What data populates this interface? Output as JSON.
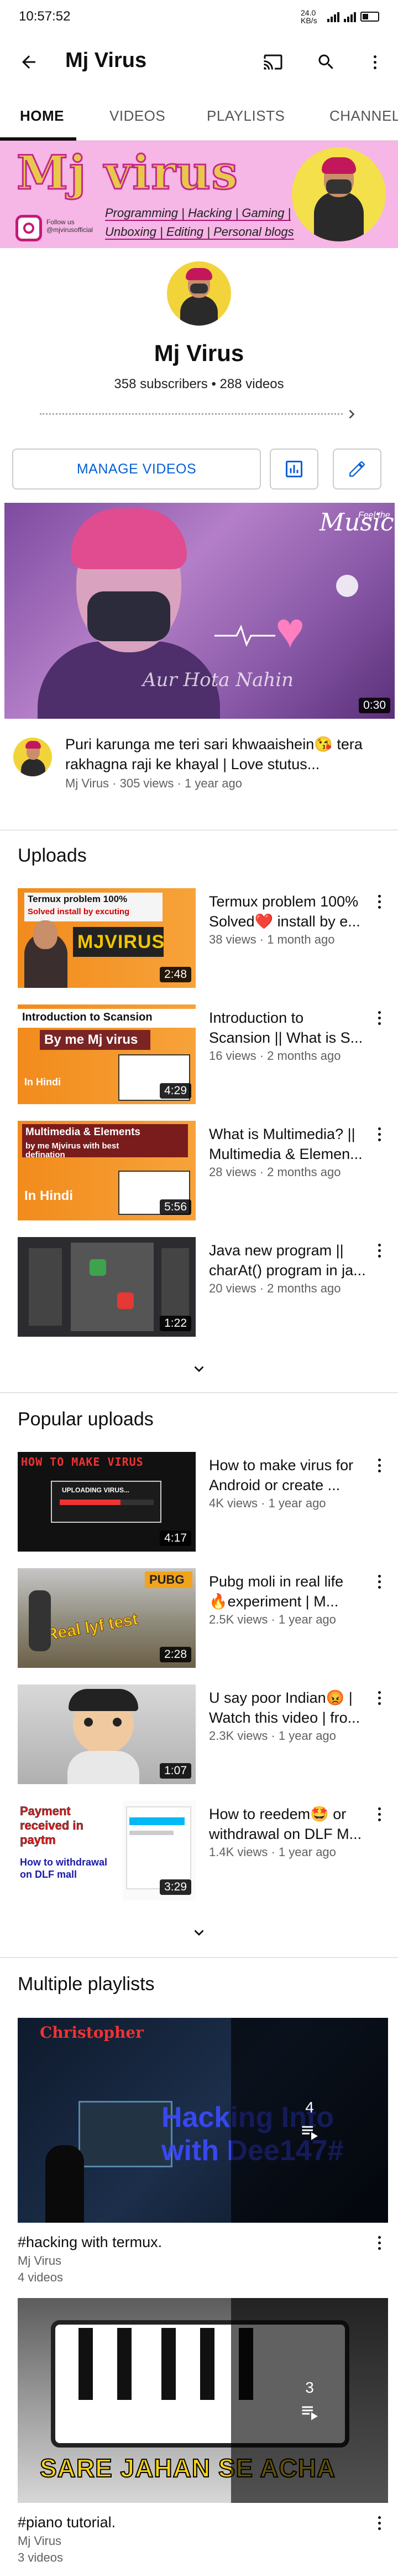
{
  "status": {
    "time": "10:57:52",
    "net_speed": "24.0 KB/s"
  },
  "appbar": {
    "title": "Mj Virus"
  },
  "tabs": [
    "HOME",
    "VIDEOS",
    "PLAYLISTS",
    "CHANNELS"
  ],
  "banner": {
    "name": "Mj virus",
    "line1": "Programming | Hacking | Gaming |",
    "line2": "Unboxing | Editing | Personal blogs",
    "follow_line1": "Follow us",
    "follow_line2": "@mjvirusofficial"
  },
  "channel": {
    "name": "Mj Virus",
    "stats": "358 subscribers • 288 videos",
    "manage_label": "MANAGE VIDEOS"
  },
  "featured": {
    "title": "Puri karunga me teri sari khwaaishein😘 tera rakhagna raji ke khayal | Love stutus...",
    "meta": "Mj Virus · 305 views · 1 year ago",
    "duration": "0:30",
    "thumb_script": "Aur Hota Nahin",
    "thumb_music": "Music",
    "thumb_feel": "Feel the"
  },
  "uploads": {
    "heading": "Uploads",
    "items": [
      {
        "title": "Termux problem 100% Solved❤️ install by e...",
        "meta": "38 views · 1 month ago",
        "duration": "2:48",
        "thumb_line1": "Termux problem 100%",
        "thumb_line2": "Solved install by excuting",
        "thumb_big": "MJVIRUS"
      },
      {
        "title": "Introduction to Scansion || What is S...",
        "meta": "16 views · 2 months ago",
        "duration": "4:29",
        "thumb_line1": "Introduction to Scansion",
        "thumb_line2": "By me Mj virus",
        "thumb_big": "In Hindi"
      },
      {
        "title": "What is Multimedia? || Multimedia & Elemen...",
        "meta": "28 views · 2 months ago",
        "duration": "5:56",
        "thumb_line1": "Multimedia & Elements",
        "thumb_line2": "by me Mjvirus with best defination",
        "thumb_big": "In Hindi"
      },
      {
        "title": "Java new program || charAt() program in ja...",
        "meta": "20 views · 2 months ago",
        "duration": "1:22",
        "thumb_line1": "",
        "thumb_line2": "",
        "thumb_big": ""
      }
    ]
  },
  "popular": {
    "heading": "Popular uploads",
    "items": [
      {
        "title": "How to make virus for Android or create ...",
        "meta": "4K views · 1 year ago",
        "duration": "4:17",
        "thumb_line1": "HOW TO MAKE VIRUS",
        "thumb_line2": "UPLOADING VIRUS...",
        "thumb_big": ""
      },
      {
        "title": "Pubg moli in real life 🔥experiment | M...",
        "meta": "2.5K views · 1 year ago",
        "duration": "2:28",
        "thumb_line1": "PUBG",
        "thumb_line2": "",
        "thumb_big": "Real lyf test"
      },
      {
        "title": "U say poor Indian😡 | Watch this video | fro...",
        "meta": "2.3K views · 1 year ago",
        "duration": "1:07",
        "thumb_line1": "",
        "thumb_line2": "",
        "thumb_big": ""
      },
      {
        "title": "How to reedem🤩 or withdrawal on DLF M...",
        "meta": "1.4K views · 1 year ago",
        "duration": "3:29",
        "thumb_line1": "Payment received in paytm",
        "thumb_line2": "How to withdrawal on DLF mall",
        "thumb_big": ""
      }
    ]
  },
  "playlists": {
    "heading": "Multiple playlists",
    "items": [
      {
        "title": "#hacking with termux.",
        "channel": "Mj Virus",
        "count_label": "4 videos",
        "count": "4",
        "thumb_text": "Hacking Into with Dee147#",
        "thumb_top": "Christopher"
      },
      {
        "title": "#piano tutorial.",
        "channel": "Mj Virus",
        "count_label": "3 videos",
        "count": "3",
        "thumb_text": "SARE JAHAN SE ACHA",
        "thumb_top": ""
      }
    ]
  }
}
